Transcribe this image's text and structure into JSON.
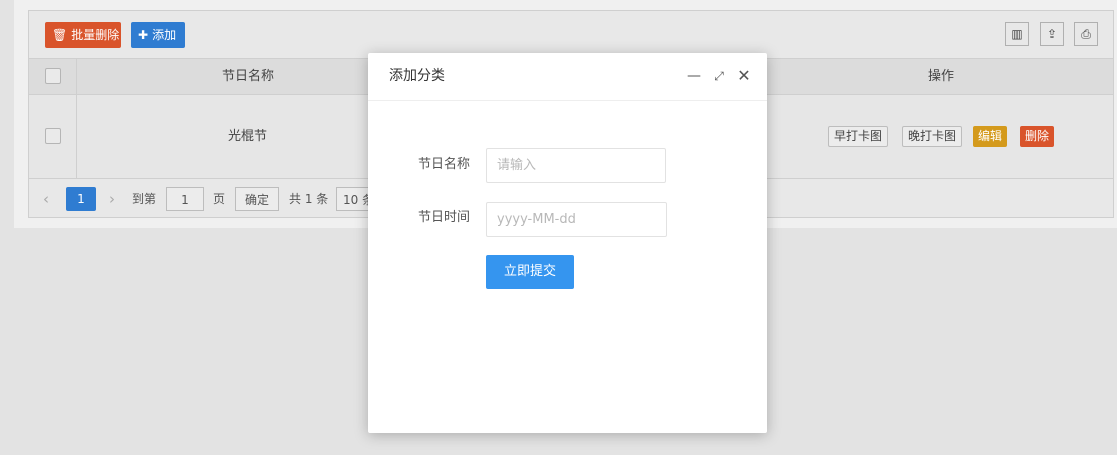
{
  "toolbar": {
    "batch_delete_label": "批量删除",
    "add_label": "添加"
  },
  "table": {
    "headers": {
      "name": "节日名称",
      "actions": "操作"
    },
    "rows": [
      {
        "name": "光棍节",
        "btn_morning": "早打卡图",
        "btn_evening": "晚打卡图",
        "btn_edit": "编辑",
        "btn_delete": "删除"
      }
    ]
  },
  "pager": {
    "current_page": "1",
    "goto_label": "到第",
    "goto_value": "1",
    "page_unit": "页",
    "confirm_label": "确定",
    "total_label": "共 1 条",
    "page_size_label": "10 条"
  },
  "dialog": {
    "title": "添加分类",
    "name_label": "节日名称",
    "name_placeholder": "请输入",
    "date_label": "节日时间",
    "date_placeholder": "yyyy-MM-dd",
    "submit_label": "立即提交"
  },
  "colors": {
    "primary": "#2f7cd1",
    "danger": "#d9542b",
    "warn": "#d49a1c",
    "submit": "#3595ef"
  }
}
